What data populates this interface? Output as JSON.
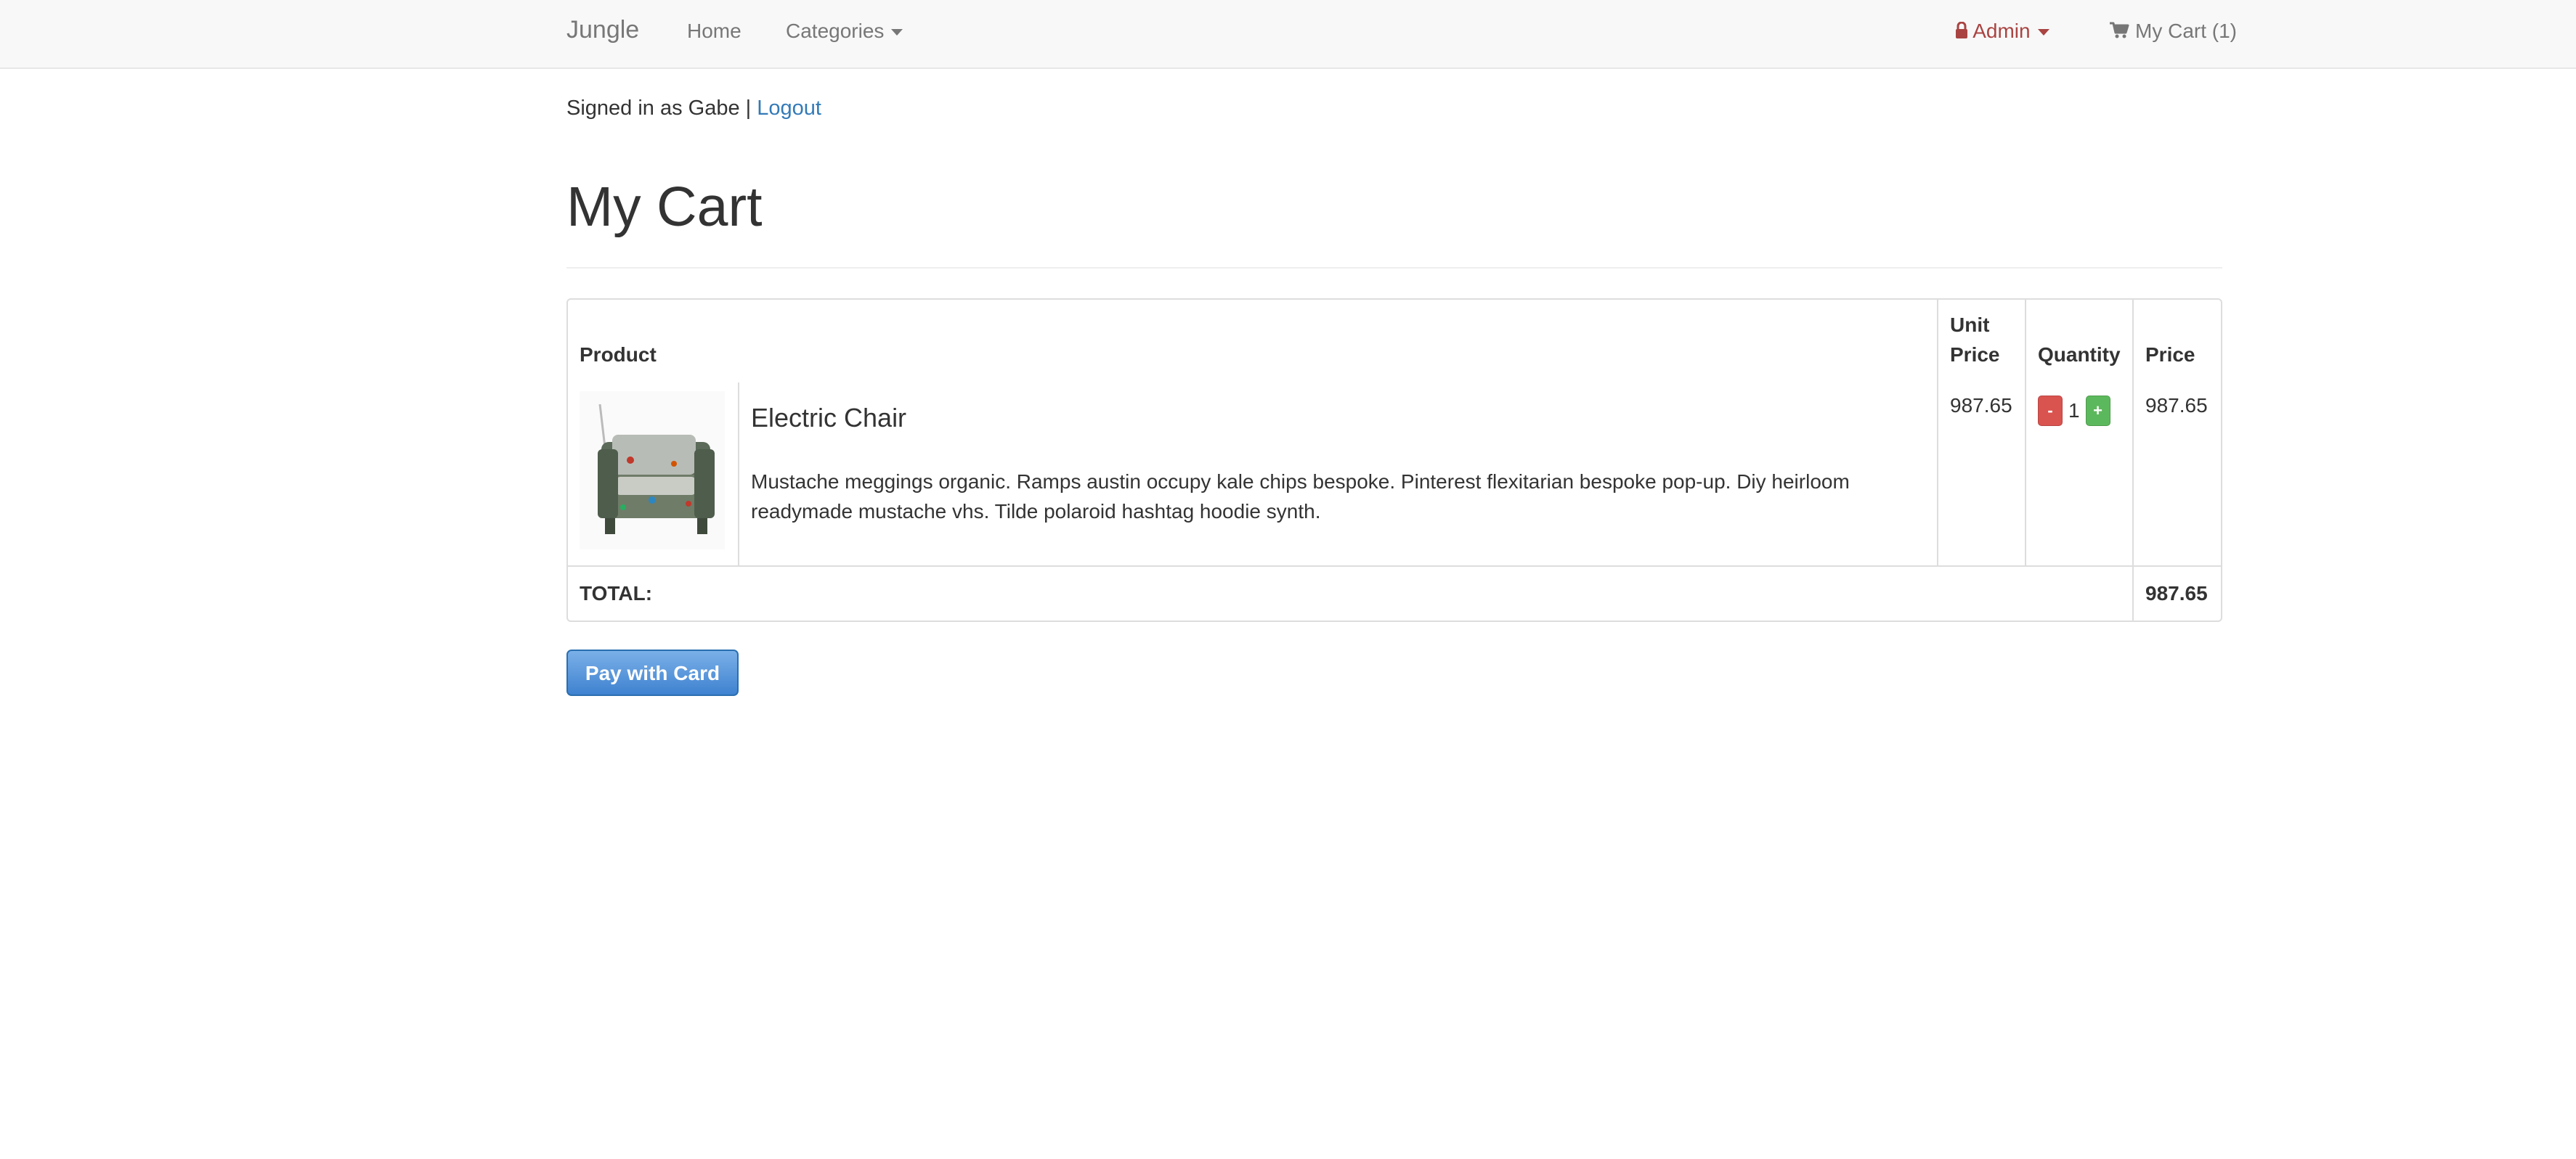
{
  "navbar": {
    "brand": "Jungle",
    "home": "Home",
    "categories": "Categories",
    "admin": "Admin",
    "cart": "My Cart (1)"
  },
  "session": {
    "signed_in_text": "Signed in as Gabe |",
    "logout": "Logout"
  },
  "page": {
    "title": "My Cart"
  },
  "table": {
    "headers": {
      "product": "Product",
      "unit_price_line1": "Unit",
      "unit_price_line2": "Price",
      "quantity": "Quantity",
      "price": "Price"
    },
    "items": [
      {
        "name": "Electric Chair",
        "description": "Mustache meggings organic. Ramps austin occupy kale chips bespoke. Pinterest flexitarian bespoke pop-up. Diy heirloom readymade mustache vhs. Tilde polaroid hashtag hoodie synth.",
        "unit_price": "987.65",
        "quantity": "1",
        "decrement": "-",
        "increment": "+",
        "price": "987.65"
      }
    ],
    "total_label": "TOTAL:",
    "total_value": "987.65"
  },
  "checkout": {
    "pay_button": "Pay with Card"
  },
  "icons": {
    "admin": "lock-icon",
    "cart": "shopping-cart-icon",
    "dropdown": "caret-down-icon"
  },
  "colors": {
    "admin_text": "#a94442",
    "link": "#337ab7",
    "decrement_button": "#d9534f",
    "increment_button": "#5cb85c",
    "pay_button": "#3f82d0"
  }
}
